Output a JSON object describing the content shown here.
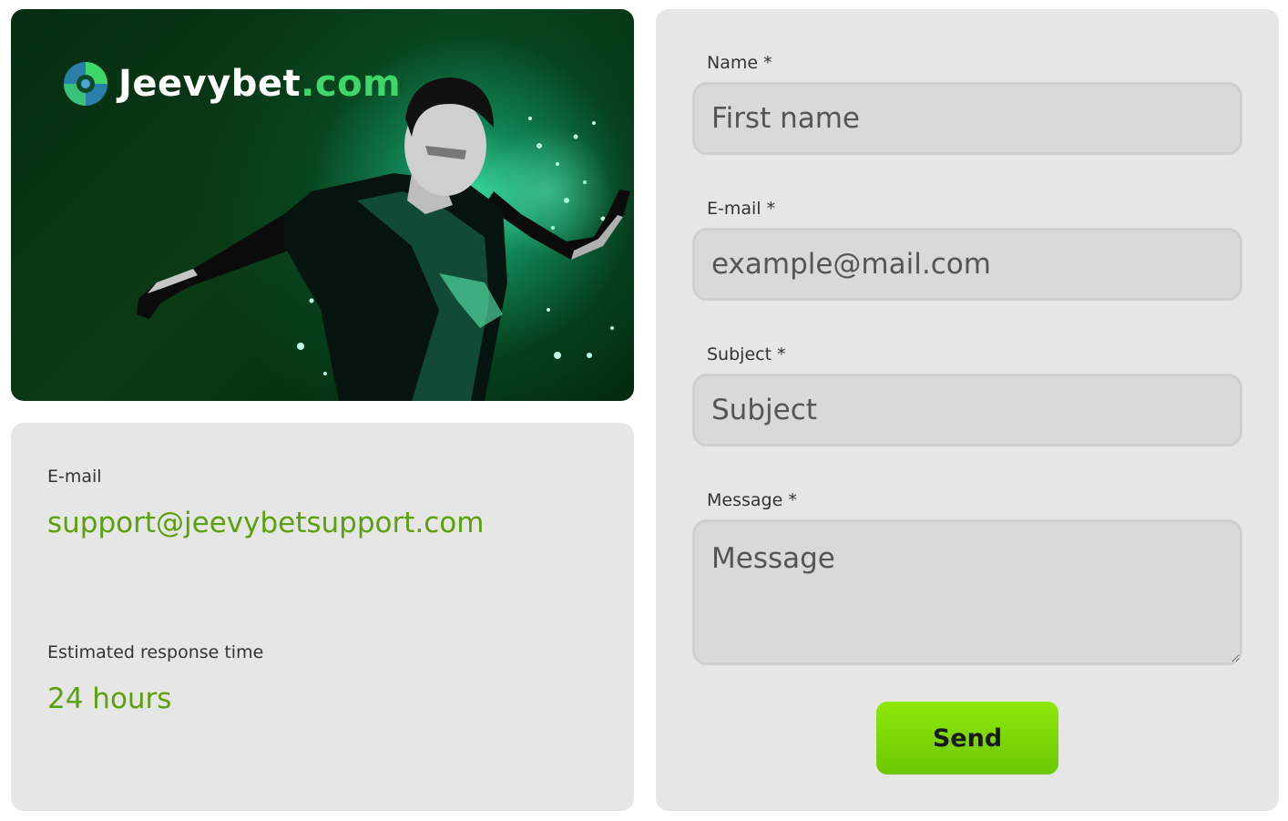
{
  "banner": {
    "brand_name": "Jeevybet",
    "brand_tld": ".com",
    "logo_icon": "globe-logo-icon",
    "image": "soccer-player-illustration"
  },
  "contact_info": {
    "email_label": "E-mail",
    "email_value": "support@jeevybetsupport.com",
    "response_label": "Estimated response time",
    "response_value": "24 hours"
  },
  "form": {
    "name_label": "Name *",
    "name_placeholder": "First name",
    "email_label": "E-mail *",
    "email_placeholder": "example@mail.com",
    "subject_label": "Subject *",
    "subject_placeholder": "Subject",
    "message_label": "Message *",
    "message_placeholder": "Message",
    "send_label": "Send"
  },
  "colors": {
    "accent_green": "#5aa10c",
    "button_green": "#7fdc05",
    "panel_bg": "#e6e6e6",
    "banner_dark": "#062e12"
  }
}
